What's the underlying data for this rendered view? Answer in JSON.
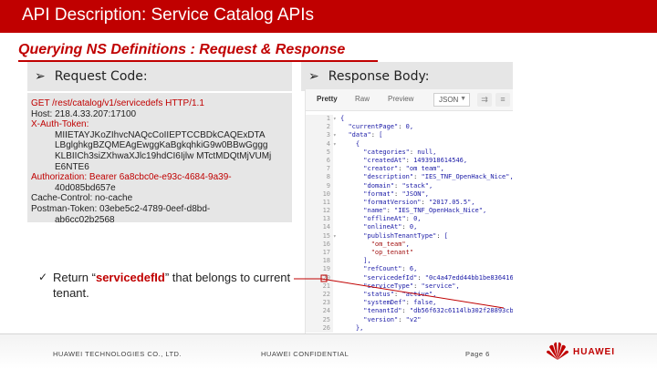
{
  "slide": {
    "title": "API Description: Service Catalog APIs",
    "subtitle": "Querying NS Definitions : Request & Response"
  },
  "request": {
    "heading": "Request Code:",
    "lines": [
      {
        "text": "GET /rest/catalog/v1/servicedefs HTTP/1.1",
        "style": "red",
        "indent": false
      },
      {
        "text": "Host: 218.4.33.207:17100",
        "style": "normal",
        "indent": false
      },
      {
        "text": "X-Auth-Token:",
        "style": "red",
        "indent": false
      },
      {
        "text": "MIIETAYJKoZIhvcNAQcCoIIEPTCCBDkCAQExDTA",
        "style": "normal",
        "indent": true
      },
      {
        "text": "LBglghkgBZQMEAgEwggKaBgkqhkiG9w0BBwGggg",
        "style": "normal",
        "indent": true
      },
      {
        "text": "KLBIICh3siZXhwaXJlc19hdCI6Ijlw MTctMDQtMjVUMj",
        "style": "normal",
        "indent": true
      },
      {
        "text": "E6NTE6",
        "style": "normal",
        "indent": true
      },
      {
        "text": "Authorization: Bearer 6a8cbc0e-e93c-4684-9a39-",
        "style": "red",
        "indent": false
      },
      {
        "text": "40d085bd657e",
        "style": "normal",
        "indent": true
      },
      {
        "text": "Cache-Control: no-cache",
        "style": "normal",
        "indent": false
      },
      {
        "text": "Postman-Token: 03ebe5c2-4789-0eef-d8bd-",
        "style": "normal",
        "indent": false
      },
      {
        "text": "ab6cc02b2568",
        "style": "normal",
        "indent": true
      }
    ]
  },
  "response": {
    "heading": "Response Body:",
    "tabs": [
      "Pretty",
      "Raw",
      "Preview"
    ],
    "active_tab": "Pretty",
    "format": "JSON",
    "lines": [
      {
        "no": "1",
        "fold": true,
        "code": "{"
      },
      {
        "no": "2",
        "fold": false,
        "code": "  \"currentPage\": 0,"
      },
      {
        "no": "3",
        "fold": true,
        "code": "  \"data\": ["
      },
      {
        "no": "4",
        "fold": true,
        "code": "    {"
      },
      {
        "no": "5",
        "fold": false,
        "code": "      \"categories\": null,"
      },
      {
        "no": "6",
        "fold": false,
        "code": "      \"createdAt\": 1493918614546,"
      },
      {
        "no": "7",
        "fold": false,
        "code": "      \"creator\": \"om team\","
      },
      {
        "no": "8",
        "fold": false,
        "code": "      \"description\": \"IES_TNF_OpenHack_Nice\","
      },
      {
        "no": "9",
        "fold": false,
        "code": "      \"domain\": \"stack\","
      },
      {
        "no": "10",
        "fold": false,
        "code": "      \"format\": \"JSON\","
      },
      {
        "no": "11",
        "fold": false,
        "code": "      \"formatVersion\": \"2017.05.5\","
      },
      {
        "no": "12",
        "fold": false,
        "code": "      \"name\": \"IES_TNF_OpenHack_Nice\","
      },
      {
        "no": "13",
        "fold": false,
        "code": "      \"offlineAt\": 0,"
      },
      {
        "no": "14",
        "fold": false,
        "code": "      \"onlineAt\": 0,"
      },
      {
        "no": "15",
        "fold": true,
        "code": "      \"publishTenantType\": ["
      },
      {
        "no": "16",
        "fold": false,
        "code": "        \"om_team\","
      },
      {
        "no": "17",
        "fold": false,
        "code": "        \"op_tenant\""
      },
      {
        "no": "18",
        "fold": false,
        "code": "      ],"
      },
      {
        "no": "19",
        "fold": false,
        "code": "      \"refCount\": 6,"
      },
      {
        "no": "20",
        "fold": false,
        "code": "      \"servicedefId\": \"0c4a47edd44bb1be8364166fcb1ab\","
      },
      {
        "no": "21",
        "fold": false,
        "code": "      \"serviceType\": \"service\","
      },
      {
        "no": "22",
        "fold": false,
        "code": "      \"status\": \"active\","
      },
      {
        "no": "23",
        "fold": false,
        "code": "      \"systemDef\": false,"
      },
      {
        "no": "24",
        "fold": false,
        "code": "      \"tenantId\": \"db56f632c6114lb302f28893cbb1555\","
      },
      {
        "no": "25",
        "fold": false,
        "code": "      \"version\": \"v2\""
      },
      {
        "no": "26",
        "fold": false,
        "code": "    },"
      }
    ]
  },
  "note": {
    "prefix": "Return “",
    "highlight": "servicedefId",
    "suffix": "” that belongs to current tenant."
  },
  "footer": {
    "left": "HUAWEI TECHNOLOGIES CO., LTD.",
    "center": "HUAWEI CONFIDENTIAL",
    "page": "Page 6",
    "logo_text": "HUAWEI"
  },
  "colors": {
    "brand": "#c00000",
    "panel": "#e6e6e6"
  }
}
